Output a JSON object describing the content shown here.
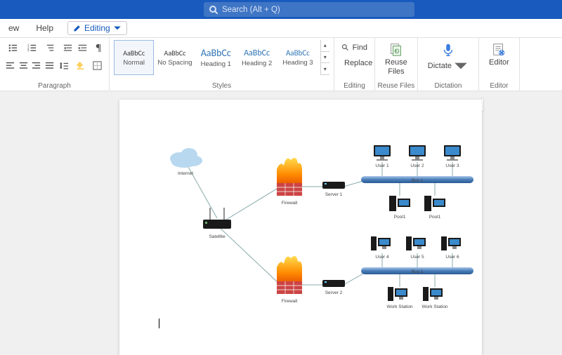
{
  "search": {
    "placeholder": "Search (Alt + Q)"
  },
  "menu": {
    "view": "ew",
    "help": "Help",
    "editing": "Editing"
  },
  "groups": {
    "paragraph": "Paragraph",
    "styles": "Styles",
    "editing": "Editing",
    "reuse": "Reuse Files",
    "dictation": "Dictation",
    "editor": "Editor"
  },
  "styles": [
    {
      "preview": "AaBbCc",
      "name": "Normal"
    },
    {
      "preview": "AaBbCc",
      "name": "No Spacing"
    },
    {
      "preview": "AaBbCc",
      "name": "Heading 1"
    },
    {
      "preview": "AaBbCc",
      "name": "Heading 2"
    },
    {
      "preview": "AaBbCc",
      "name": "Heading 3"
    }
  ],
  "editing": {
    "find": "Find",
    "replace": "Replace"
  },
  "reuse": {
    "label": "Reuse",
    "sub": "Files"
  },
  "dictate": "Dictate",
  "editor": "Editor",
  "diagram": {
    "internet": "Internet",
    "satellite": "Satellite",
    "firewall1": "Firewall",
    "firewall2": "Firewall",
    "server1": "Server 1",
    "server2": "Server 2",
    "user1": "User 1",
    "user2": "User 2",
    "user3": "User 3",
    "user4": "User 4",
    "user5": "User 5",
    "user6": "User 6",
    "pool1": "Pool1",
    "pool2": "Pool1",
    "bus1": "Bus 1",
    "bus2": "Bus 1",
    "ws1": "Work Station",
    "ws2": "Work Station"
  }
}
